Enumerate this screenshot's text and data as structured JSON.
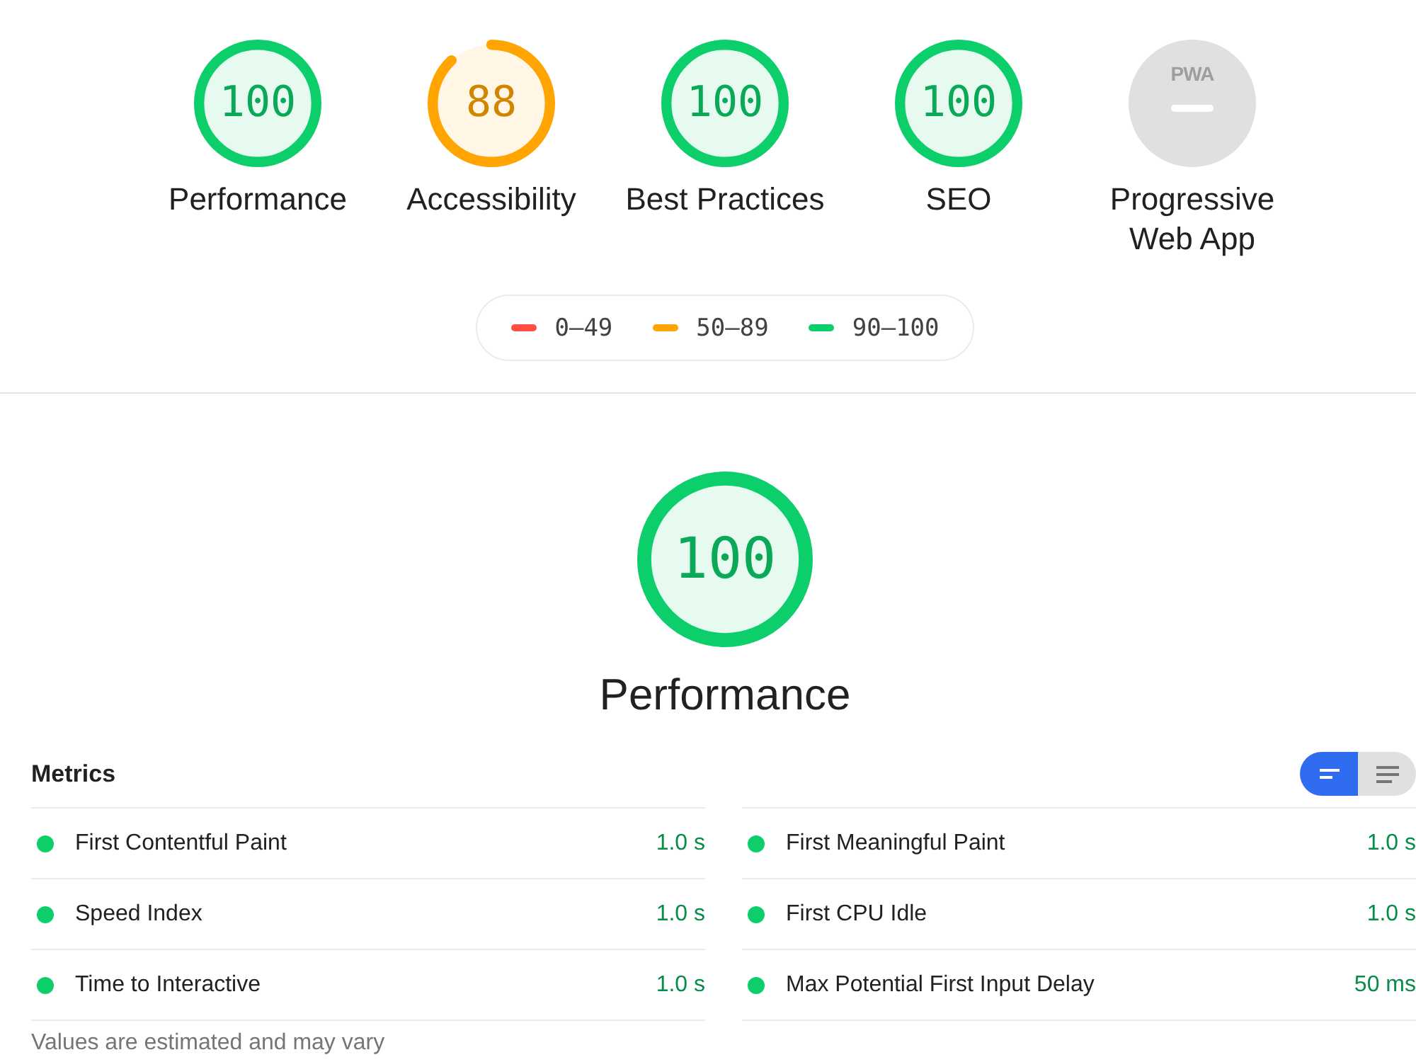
{
  "gauges": [
    {
      "kind": "score",
      "score": "100",
      "level": 1,
      "color": "#0cce6b",
      "label": "Performance"
    },
    {
      "kind": "score",
      "score": "88",
      "level": 0.88,
      "color": "#ffa400",
      "label": "Accessibility"
    },
    {
      "kind": "score",
      "score": "100",
      "level": 1,
      "color": "#0cce6b",
      "label": "Best Practices"
    },
    {
      "kind": "score",
      "score": "100",
      "level": 1,
      "color": "#0cce6b",
      "label": "SEO"
    },
    {
      "kind": "pwa",
      "badge": "PWA",
      "label": "Progressive Web App"
    }
  ],
  "legend": [
    {
      "range": "0–49",
      "color": "#ff4e42"
    },
    {
      "range": "50–89",
      "color": "#ffa400"
    },
    {
      "range": "90–100",
      "color": "#0cce6b"
    }
  ],
  "category": {
    "score": "100",
    "level": 1,
    "color": "#0cce6b",
    "label": "Performance"
  },
  "metrics_section": {
    "title": "Metrics",
    "view_toggle": [
      {
        "kind": "compact",
        "selected": true
      },
      {
        "kind": "detailed",
        "selected": false
      }
    ],
    "metrics": [
      {
        "name": "First Contentful Paint",
        "value": "1.0 s",
        "color": "#0cce6b"
      },
      {
        "name": "First Meaningful Paint",
        "value": "1.0 s",
        "color": "#0cce6b"
      },
      {
        "name": "Speed Index",
        "value": "1.0 s",
        "color": "#0cce6b"
      },
      {
        "name": "First CPU Idle",
        "value": "1.0 s",
        "color": "#0cce6b"
      },
      {
        "name": "Time to Interactive",
        "value": "1.0 s",
        "color": "#0cce6b"
      },
      {
        "name": "Max Potential First Input Delay",
        "value": "50 ms",
        "color": "#0cce6b"
      }
    ],
    "footnote": "Values are estimated and may vary"
  }
}
